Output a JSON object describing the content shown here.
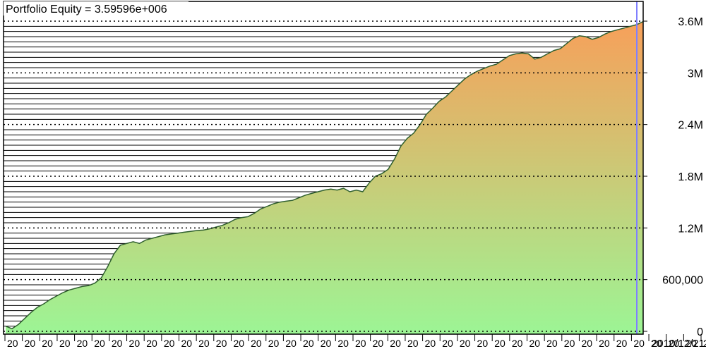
{
  "title": "Portfolio Equity = 3.59596e+006",
  "chart_data": {
    "type": "area",
    "title": "Portfolio Equity = 3.59596e+006",
    "xlabel": "",
    "ylabel": "",
    "ylim": [
      0,
      3600000
    ],
    "y_ticks": [
      {
        "value": 0,
        "label": "0"
      },
      {
        "value": 600000,
        "label": "600,000"
      },
      {
        "value": 1200000,
        "label": "1.2M"
      },
      {
        "value": 1800000,
        "label": "1.8M"
      },
      {
        "value": 2400000,
        "label": "2.4M"
      },
      {
        "value": 3000000,
        "label": "3M"
      },
      {
        "value": 3600000,
        "label": "3.6M"
      }
    ],
    "x_tick_labels": [
      "20",
      "20",
      "20",
      "20",
      "20",
      "20",
      "20",
      "20",
      "20",
      "20",
      "20",
      "20",
      "20",
      "20",
      "20",
      "20",
      "20",
      "20",
      "20",
      "20",
      "20",
      "20",
      "20",
      "20",
      "20",
      "20",
      "20",
      "20",
      "20",
      "20",
      "20",
      "20",
      "20",
      "20",
      "20",
      "20",
      "20",
      "20",
      "20",
      "20",
      "20",
      "20",
      "20",
      "20",
      "20",
      "20",
      "20",
      "20"
    ],
    "last_date_label": "2010/12/21",
    "grid": true,
    "legend": "none",
    "fill_gradient": {
      "low": "#9cf595",
      "high": "#f7a05a"
    },
    "line_color": "#2f5f2f",
    "cursor_color": "#8080ff",
    "series": [
      {
        "x": [
          0,
          1,
          2,
          3,
          4,
          5,
          6,
          7,
          8,
          9,
          10,
          11,
          12,
          13,
          14,
          15,
          16,
          17,
          18,
          19,
          20,
          21,
          22,
          23,
          24,
          25,
          26,
          27,
          28,
          29,
          30,
          31,
          32,
          33,
          34,
          35,
          36,
          37,
          38,
          39,
          40,
          41,
          42,
          43,
          44,
          45,
          46,
          47,
          48,
          49,
          50,
          51,
          52,
          53,
          54,
          55,
          56,
          57,
          58,
          59,
          60,
          61,
          62,
          63,
          64,
          65,
          66,
          67,
          68,
          69,
          70,
          71,
          72,
          73,
          74,
          75,
          76,
          77,
          78,
          79,
          80,
          81,
          82,
          83,
          84,
          85,
          86,
          87,
          88,
          89,
          90,
          91,
          92,
          93,
          94,
          95,
          96,
          97,
          98,
          99,
          100
        ],
        "values": [
          60000,
          30000,
          80000,
          150000,
          220000,
          280000,
          320000,
          370000,
          410000,
          450000,
          480000,
          500000,
          520000,
          530000,
          560000,
          620000,
          750000,
          900000,
          1000000,
          1020000,
          1040000,
          1020000,
          1060000,
          1080000,
          1100000,
          1120000,
          1130000,
          1140000,
          1150000,
          1160000,
          1170000,
          1175000,
          1190000,
          1210000,
          1230000,
          1260000,
          1300000,
          1320000,
          1330000,
          1370000,
          1420000,
          1450000,
          1480000,
          1500000,
          1510000,
          1520000,
          1550000,
          1580000,
          1600000,
          1620000,
          1640000,
          1650000,
          1640000,
          1660000,
          1620000,
          1640000,
          1620000,
          1720000,
          1800000,
          1830000,
          1880000,
          2000000,
          2150000,
          2240000,
          2300000,
          2400000,
          2520000,
          2590000,
          2670000,
          2720000,
          2790000,
          2860000,
          2930000,
          2980000,
          3020000,
          3050000,
          3080000,
          3100000,
          3150000,
          3200000,
          3220000,
          3230000,
          3220000,
          3160000,
          3180000,
          3220000,
          3260000,
          3280000,
          3340000,
          3400000,
          3430000,
          3420000,
          3390000,
          3410000,
          3450000,
          3480000,
          3500000,
          3520000,
          3540000,
          3560000,
          3595960
        ]
      }
    ]
  }
}
